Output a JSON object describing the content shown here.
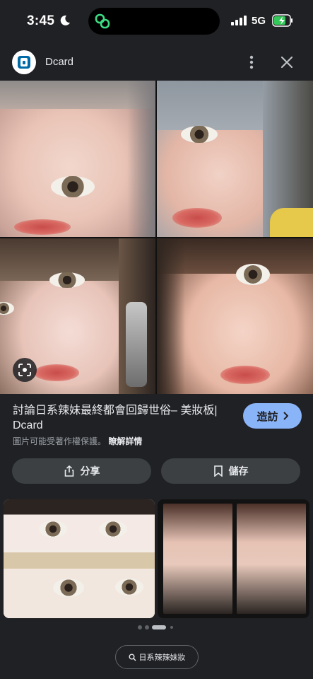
{
  "status_bar": {
    "time": "3:45",
    "network": "5G",
    "icons": [
      "moon-icon",
      "call-activity-icon",
      "signal-icon",
      "battery-charging-icon"
    ],
    "battery_color": "#34c759"
  },
  "header": {
    "site_name": "Dcard",
    "icons": [
      "dcard-logo-icon",
      "more-vert-icon",
      "close-icon"
    ]
  },
  "result": {
    "title": "討論日系辣妹最終都會回歸世俗– 美妝板| Dcard",
    "visit_label": "造訪",
    "copyright_text": "圖片可能受著作權保護。",
    "learn_more": "瞭解詳情",
    "share_label": "分享",
    "save_label": "儲存"
  },
  "pager": {
    "count": 4,
    "active": 2
  },
  "search_chip": {
    "label": "日系辣辣妹妝"
  },
  "colors": {
    "background": "#202124",
    "accent": "#8ab4f8",
    "button_bg": "#3c4043"
  }
}
